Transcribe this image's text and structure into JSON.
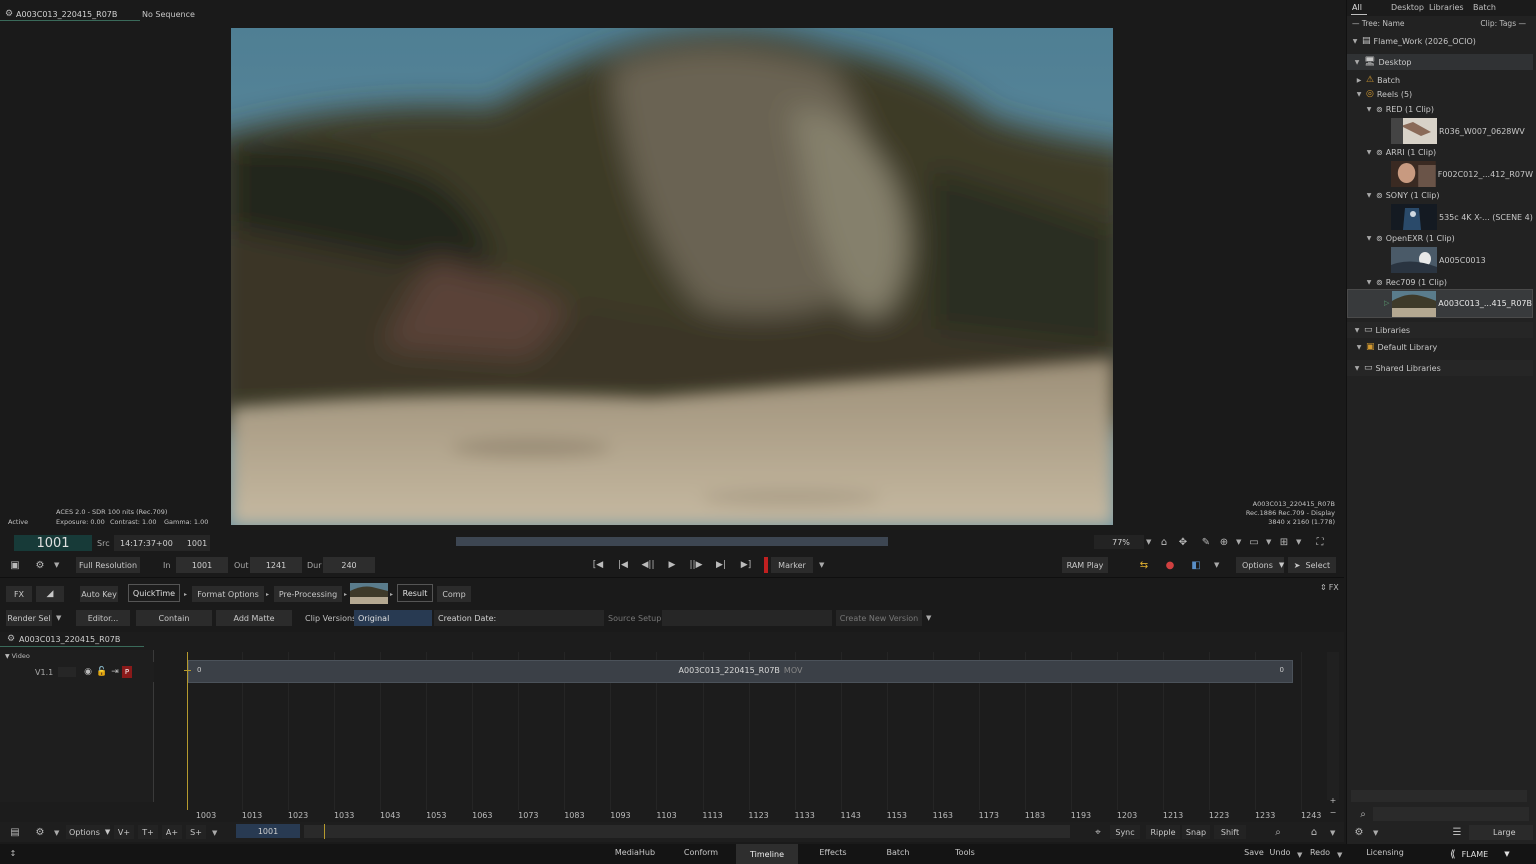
{
  "viewer": {
    "clip_name": "A003C013_220415_R07B",
    "sequence": "No Sequence",
    "status": "Active",
    "lut_info": "ACES 2.0 - SDR 100 nits (Rec.709)",
    "exposure": "Exposure: 0.00",
    "contrast": "Contrast: 1.00",
    "gamma": "Gamma: 1.00",
    "meta_name": "A003C013_220415_R07B",
    "meta_display": "Rec.1886 Rec.709 - Display",
    "meta_res": "3840 x 2160 (1.778)"
  },
  "transport": {
    "frame": "1001",
    "src_label": "Src",
    "timecode": "14:17:37+00",
    "src_frame": "1001",
    "resolution": "Full Resolution",
    "in_label": "In",
    "in_value": "1001",
    "out_label": "Out",
    "out_value": "1241",
    "dur_label": "Dur",
    "dur_value": "240",
    "marker": "Marker",
    "ram_play": "RAM Play",
    "zoom": "77%",
    "options": "Options",
    "select": "Select",
    "fx": "FX"
  },
  "tools": {
    "fx": "FX",
    "auto_key": "Auto Key",
    "quicktime": "QuickTime",
    "format_options": "Format Options",
    "pre_processing": "Pre-Processing",
    "result": "Result",
    "comp": "Comp",
    "render_sel": "Render Sel",
    "editor": "Editor...",
    "contain": "Contain",
    "add_matte": "Add Matte",
    "clip_versions_label": "Clip Versions",
    "clip_versions_value": "Original",
    "creation_date": "Creation Date:",
    "source_setup": "Source Setup",
    "create_new_version": "Create New Version"
  },
  "timeline": {
    "sequence_name": "A003C013_220415_R07B",
    "video_label": "Video",
    "track": "V1.1",
    "track_p": "P",
    "segment_name": "A003C013_220415_R07B",
    "segment_type": "MOV",
    "seg_start": "0",
    "seg_end": "0",
    "ticks": [
      "1003",
      "1013",
      "1023",
      "1033",
      "1043",
      "1053",
      "1063",
      "1073",
      "1083",
      "1093",
      "1103",
      "1113",
      "1123",
      "1133",
      "1143",
      "1153",
      "1163",
      "1173",
      "1183",
      "1193",
      "1203",
      "1213",
      "1223",
      "1233",
      "1243"
    ]
  },
  "timeline_toolbar": {
    "options": "Options",
    "v_plus": "V+",
    "t_plus": "T+",
    "a_plus": "A+",
    "s_plus": "S+",
    "frame": "1001",
    "sync": "Sync",
    "ripple": "Ripple",
    "snap": "Snap",
    "shift": "Shift"
  },
  "browser": {
    "tabs": [
      "All",
      "Desktop",
      "Libraries",
      "Batch"
    ],
    "tree_label": "— Tree: Name",
    "clip_tags": "Clip: Tags —",
    "project": "Flame_Work (2026_OCIO)",
    "desktop": "Desktop",
    "batch": "Batch",
    "reels": "Reels (5)",
    "reel_red": "RED (1 Clip)",
    "clip_red": "R036_W007_0628WV",
    "reel_arri": "ARRI (1 Clip)",
    "clip_arri": "F002C012_...412_R07W",
    "reel_sony": "SONY (1 Clip)",
    "clip_sony": "535c 4K X-... (SCENE 4)",
    "reel_exr": "OpenEXR (1 Clip)",
    "clip_exr": "A005C0013",
    "reel_rec709": "Rec709 (1 Clip)",
    "clip_rec709": "A003C013_...415_R07B",
    "libraries": "Libraries",
    "default_library": "Default Library",
    "shared_libraries": "Shared Libraries",
    "size": "Large"
  },
  "bottom_bar": {
    "tabs": [
      "MediaHub",
      "Conform",
      "Timeline",
      "Effects",
      "Batch",
      "Tools"
    ],
    "active_tab": "Timeline",
    "save": "Save",
    "undo": "Undo",
    "redo": "Redo",
    "licensing": "Licensing",
    "brand": "FLAME"
  },
  "colors": {
    "accent_teal": "#173a38",
    "playhead": "#b59a2e",
    "marker_red": "#c02020",
    "segment": "#3b4047"
  }
}
